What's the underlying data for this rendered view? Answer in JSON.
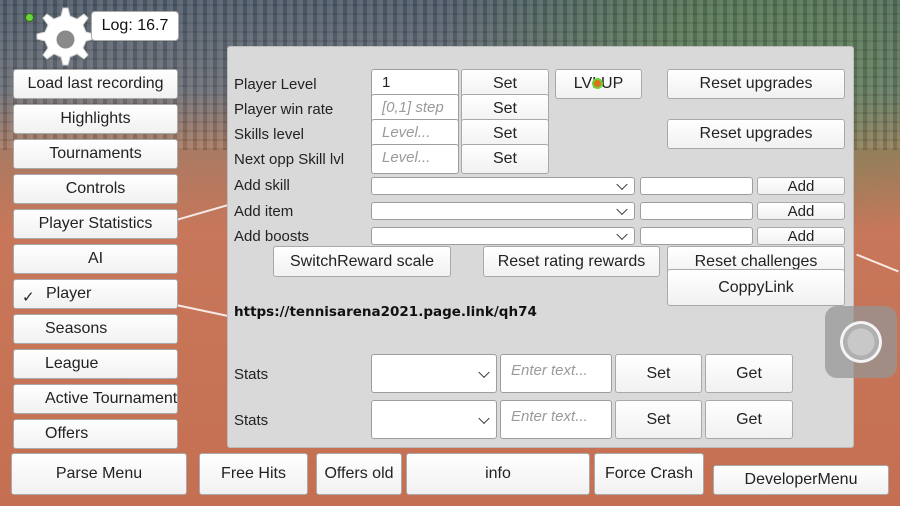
{
  "log": {
    "label": "Log: 16.7"
  },
  "sidebar": {
    "items": [
      {
        "label": "Load last recording"
      },
      {
        "label": "Highlights"
      },
      {
        "label": "Tournaments"
      },
      {
        "label": "Controls"
      },
      {
        "label": "Player Statistics"
      },
      {
        "label": "AI"
      },
      {
        "label": "Player",
        "checked": true,
        "check_glyph": "✓"
      },
      {
        "label": "Seasons"
      },
      {
        "label": "League"
      },
      {
        "label": "Active Tournament"
      },
      {
        "label": "Offers"
      }
    ]
  },
  "panel": {
    "player_level": {
      "label": "Player Level",
      "value": "1",
      "set": "Set",
      "lvlup": "LVLUP",
      "reset": "Reset upgrades"
    },
    "win_rate": {
      "label": "Player win rate",
      "placeholder": "[0,1] step",
      "set": "Set"
    },
    "skills_level": {
      "label": "Skills level",
      "placeholder": "Level...",
      "set": "Set",
      "reset": "Reset upgrades"
    },
    "next_opp": {
      "label": "Next opp Skill lvl",
      "placeholder": "Level...",
      "set": "Set"
    },
    "add_skill": {
      "label": "Add skill",
      "add": "Add"
    },
    "add_item": {
      "label": "Add item",
      "add": "Add"
    },
    "add_boosts": {
      "label": "Add boosts",
      "add": "Add"
    },
    "switch_reward": "SwitchReward scale",
    "reset_rating": "Reset rating rewards",
    "reset_challenges": "Reset challenges",
    "copy_link": "CoppyLink",
    "link": "https://tennisarena2021.page.link/qh74",
    "stats": [
      {
        "label": "Stats",
        "placeholder": "Enter text...",
        "set": "Set",
        "get": "Get"
      },
      {
        "label": "Stats",
        "placeholder": "Enter text...",
        "set": "Set",
        "get": "Get"
      }
    ]
  },
  "bottom": {
    "parse_menu": "Parse Menu",
    "free_hits": "Free Hits",
    "offers_old": "Offers old",
    "info": "info",
    "force_crash": "Force Crash",
    "developer_menu": "DeveloperMenu"
  },
  "colors": {
    "panel_bg": "#d9d9d9",
    "court": "#c56f52",
    "marker_green": "#6bd23a",
    "marker_orange": "#e0701a"
  },
  "icons": [
    "gear-icon",
    "chevron-down-icon",
    "check-icon",
    "joystick-icon"
  ]
}
